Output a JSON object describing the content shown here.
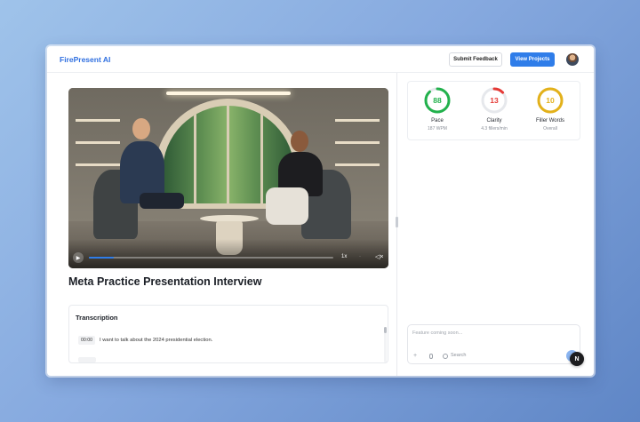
{
  "header": {
    "brand": "FirePresent AI",
    "submit_feedback_label": "Submit Feedback",
    "view_projects_label": "View Projects"
  },
  "video": {
    "speed_label": "1x",
    "progress": 0.1
  },
  "page_title": "Meta Practice Presentation Interview",
  "metrics": [
    {
      "score": "88",
      "label": "Pace",
      "sub": "187 WPM",
      "color": "#22b14c",
      "fraction": 0.88
    },
    {
      "score": "13",
      "label": "Clarity",
      "sub": "4.3 fillers/min",
      "color": "#e53935",
      "fraction": 0.13
    },
    {
      "score": "10",
      "label": "Filler Words",
      "sub": "Overall",
      "color": "#e3b11a",
      "fraction": 1.0
    }
  ],
  "transcription": {
    "title": "Transcription",
    "entries": [
      {
        "time": "00:00",
        "text": "I want to talk about the 2024 presidential election."
      }
    ]
  },
  "chat": {
    "placeholder": "Feature coming soon...",
    "search_label": "Search"
  },
  "badge_letter": "N",
  "icons": {
    "play": "play-icon",
    "volume": "volume-mute-icon",
    "plus": "plus-icon",
    "mic": "microphone-icon",
    "globe": "globe-icon",
    "send": "send-icon"
  }
}
